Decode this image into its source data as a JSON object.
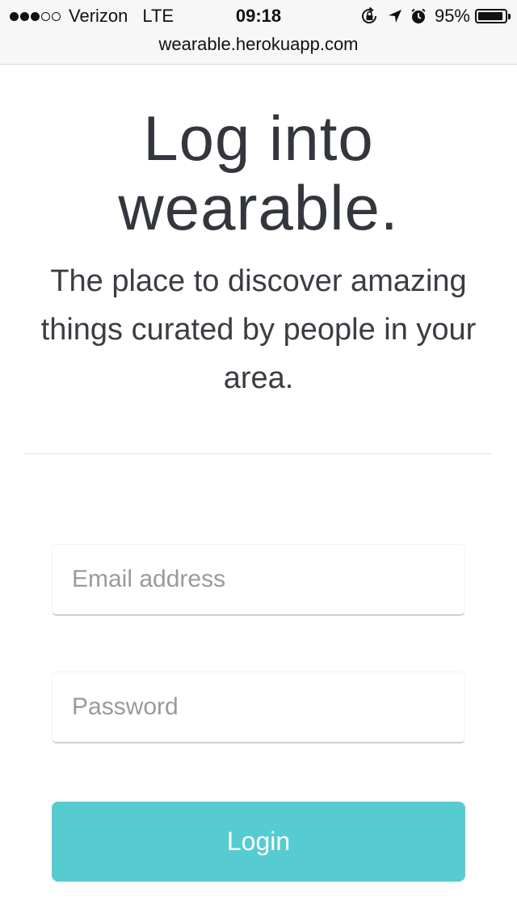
{
  "status_bar": {
    "carrier": "Verizon",
    "network": "LTE",
    "time": "09:18",
    "battery_percent": "95%",
    "battery_level": 0.95,
    "signal_bars_filled": 3,
    "signal_bars_total": 5,
    "icons": [
      "orientation-lock-icon",
      "location-arrow-icon",
      "alarm-icon",
      "battery-icon"
    ]
  },
  "browser": {
    "url": "wearable.herokuapp.com"
  },
  "page": {
    "title_line1": "Log into",
    "title_line2": "wearable.",
    "subtitle": "The place to discover amazing things curated by people in your area."
  },
  "form": {
    "email": {
      "value": "",
      "placeholder": "Email address"
    },
    "password": {
      "value": "",
      "placeholder": "Password"
    },
    "login_label": "Login"
  },
  "colors": {
    "accent": "#56ccd1",
    "text": "#33373d",
    "status_bar_bg": "#f7f7f7"
  }
}
